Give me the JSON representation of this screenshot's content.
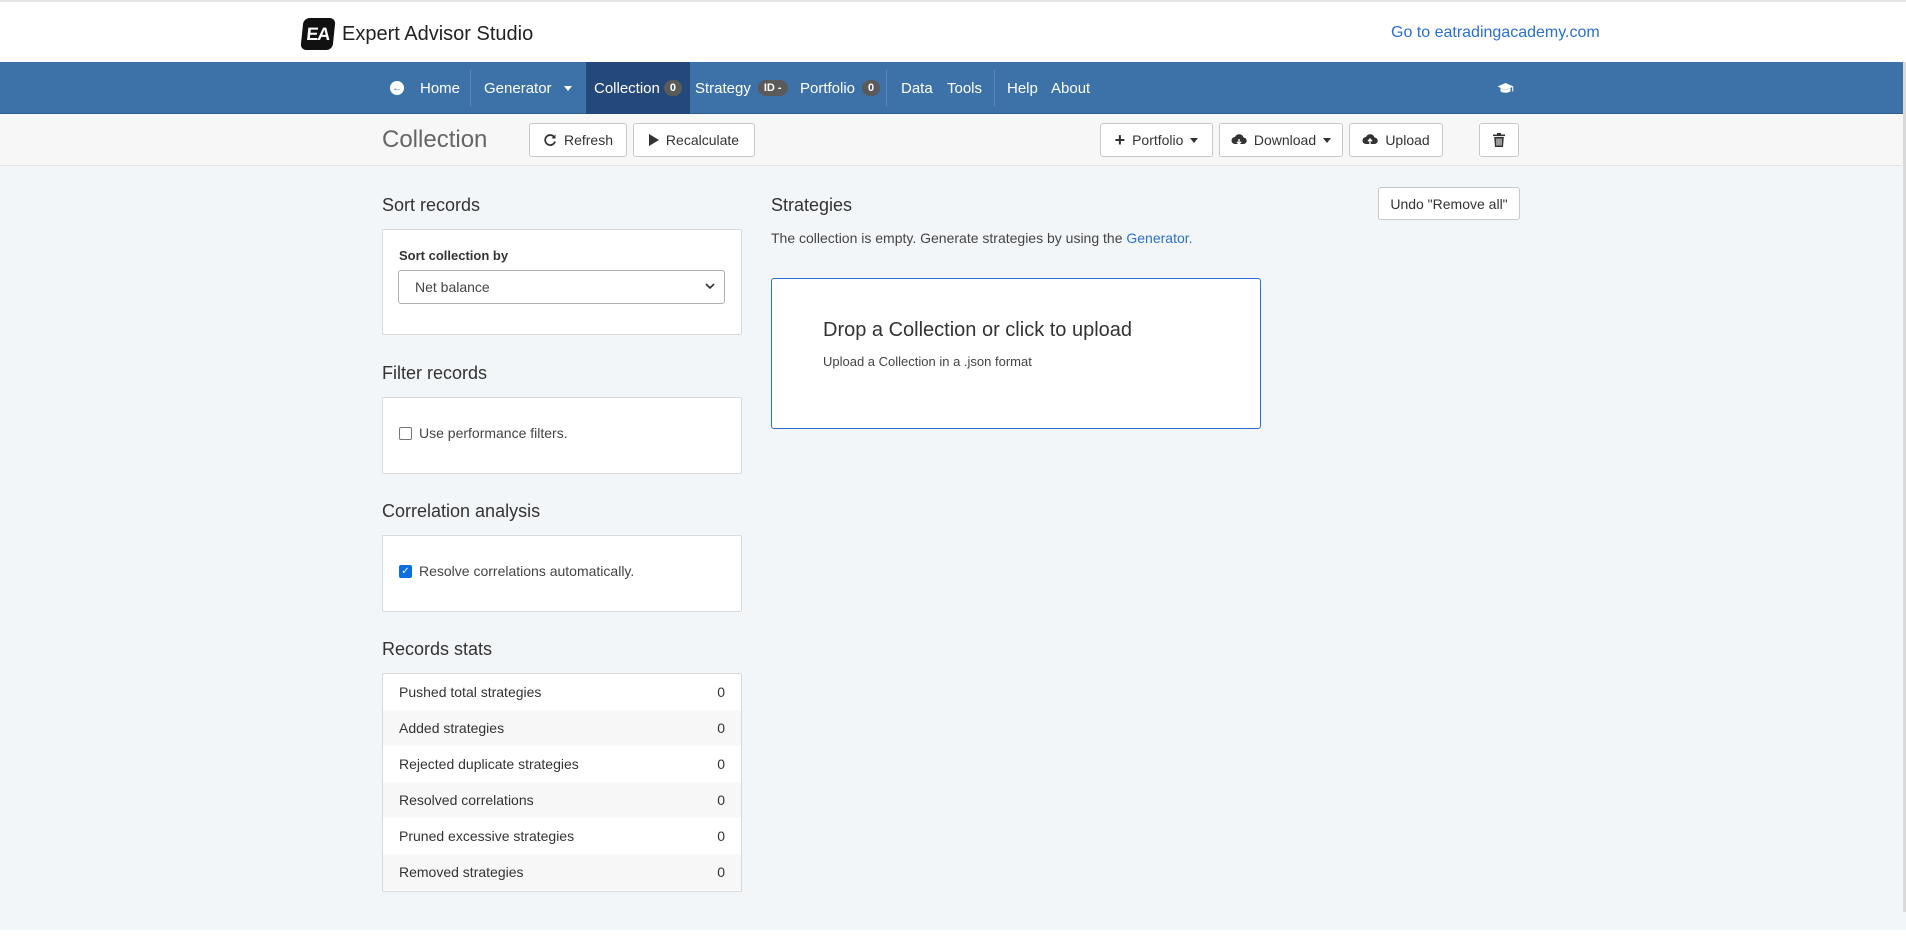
{
  "header": {
    "logo_text": "EA",
    "brand_name": "Expert Advisor Studio",
    "external_link": "Go to eatradingacademy.com"
  },
  "nav": {
    "home": "Home",
    "generator": "Generator",
    "collection": "Collection",
    "collection_count": "0",
    "strategy": "Strategy",
    "strategy_badge": "ID -",
    "portfolio": "Portfolio",
    "portfolio_count": "0",
    "data": "Data",
    "tools": "Tools",
    "help": "Help",
    "about": "About",
    "icons": [
      "arrow-left-circle-icon",
      "caret-down-icon",
      "graduation-cap-icon"
    ]
  },
  "toolbar": {
    "title": "Collection",
    "refresh": "Refresh",
    "recalculate": "Recalculate",
    "portfolio": "Portfolio",
    "download": "Download",
    "upload": "Upload",
    "icons": [
      "refresh-icon",
      "play-icon",
      "plus-icon",
      "cloud-download-icon",
      "cloud-upload-icon",
      "trash-icon"
    ]
  },
  "sort": {
    "section_title": "Sort records",
    "label": "Sort collection by",
    "selected": "Net balance"
  },
  "filter": {
    "section_title": "Filter records",
    "checkbox_label": "Use performance filters.",
    "checked": false
  },
  "correlation": {
    "section_title": "Correlation analysis",
    "checkbox_label": "Resolve correlations automatically.",
    "checked": true
  },
  "stats": {
    "section_title": "Records stats",
    "rows": [
      {
        "label": "Pushed total strategies",
        "value": "0"
      },
      {
        "label": "Added strategies",
        "value": "0"
      },
      {
        "label": "Rejected duplicate strategies",
        "value": "0"
      },
      {
        "label": "Resolved correlations",
        "value": "0"
      },
      {
        "label": "Pruned excessive strategies",
        "value": "0"
      },
      {
        "label": "Removed strategies",
        "value": "0"
      }
    ]
  },
  "strategies": {
    "section_title": "Strategies",
    "undo_button": "Undo \"Remove all\"",
    "empty_text": "The collection is empty. Generate strategies by using the",
    "generator_link": "Generator.",
    "dropzone_title": "Drop a Collection or click to upload",
    "dropzone_sub": "Upload a Collection in a .json format"
  },
  "colors": {
    "navbar": "#3d72a8",
    "navbar_active": "#24487a",
    "link": "#2a6fd1",
    "checkbox_checked": "#0b6fde"
  }
}
